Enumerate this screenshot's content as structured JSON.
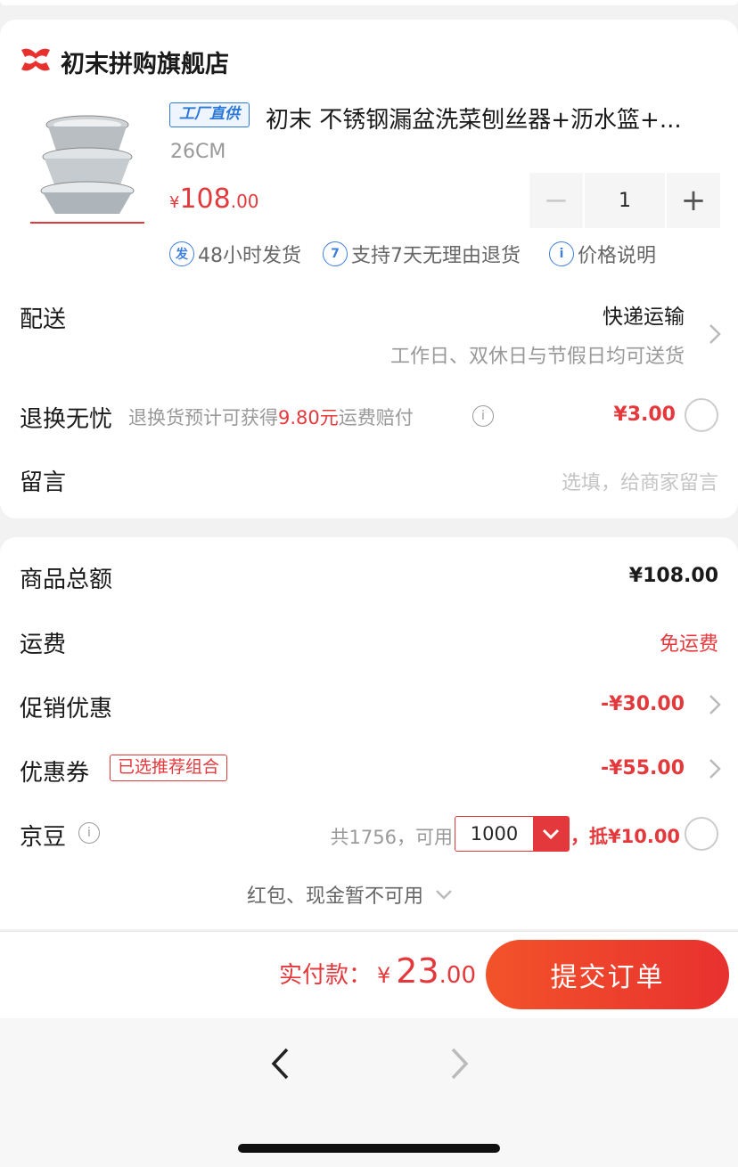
{
  "store": {
    "name": "初末拼购旗舰店"
  },
  "product": {
    "tag": "工厂直供",
    "title": "初末 不锈钢漏盆洗菜刨丝器+沥水篮+...",
    "spec": "26CM",
    "price_currency": "¥",
    "price_int": "108",
    "price_dec": ".00",
    "quantity": "1",
    "minus": "−",
    "plus": "+",
    "services": [
      {
        "icon": "发",
        "label": "48小时发货"
      },
      {
        "icon": "7",
        "label": "支持7天无理由退货"
      },
      {
        "icon": "i",
        "label": "价格说明"
      }
    ]
  },
  "delivery": {
    "label": "配送",
    "method": "快递运输",
    "note": "工作日、双休日与节假日均可送货"
  },
  "return_guard": {
    "label": "退换无忧",
    "desc_prefix": "退换货预计可获得",
    "desc_amount": "9.80元",
    "desc_suffix": "运费赔付",
    "price": "¥3.00"
  },
  "message": {
    "label": "留言",
    "placeholder": "选填，给商家留言"
  },
  "summary": {
    "goods_total_label": "商品总额",
    "goods_total_value": "¥108.00",
    "shipping_label": "运费",
    "shipping_value": "免运费",
    "promo_label": "促销优惠",
    "promo_value": "-¥30.00",
    "coupon_label": "优惠券",
    "coupon_tag": "已选推荐组合",
    "coupon_value": "-¥55.00",
    "beans_label": "京豆",
    "beans_avail": "共1756，可用",
    "beans_selected": "1000",
    "beans_deduct": "，抵¥10.00",
    "redpacket_note": "红包、现金暂不可用"
  },
  "footer": {
    "pay_label": "实付款：",
    "pay_currency": "¥",
    "pay_int": "23",
    "pay_dec": ".00",
    "submit_label": "提交订单"
  },
  "colors": {
    "accent_red": "#e4393c",
    "link_blue": "#3d7fdb"
  }
}
